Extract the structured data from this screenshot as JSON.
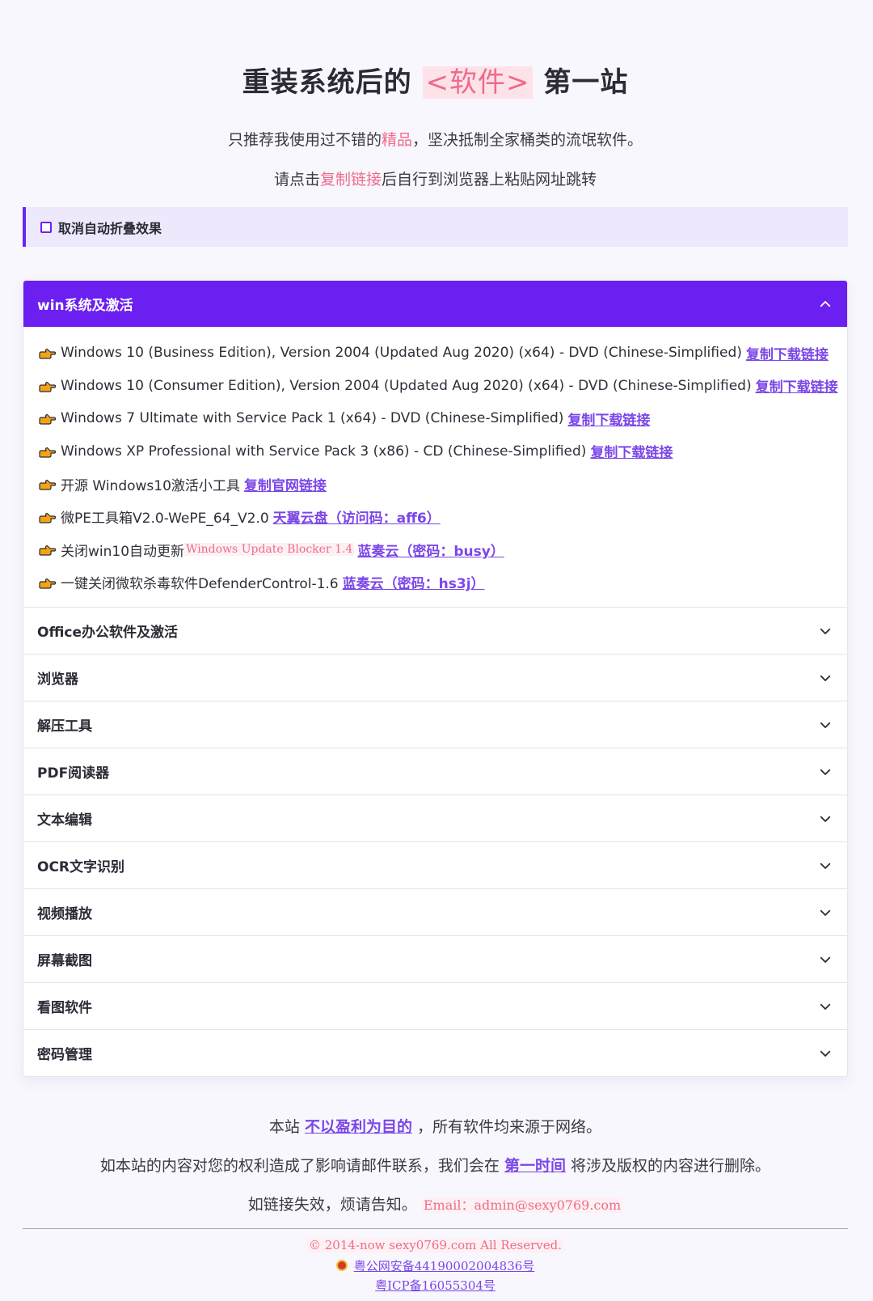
{
  "hero": {
    "title_before": "重装系统后的",
    "title_highlight": "<软件>",
    "title_after": "第一站",
    "line1_before": "只推荐我使用过不错的",
    "line1_highlight": "精品",
    "line1_after": "，坚决抵制全家桶类的流氓软件。",
    "line2_before": "请点击",
    "line2_highlight": "复制链接",
    "line2_after": "后自行到浏览器上粘贴网址跳转"
  },
  "toggle": {
    "label": "取消自动折叠效果"
  },
  "accordion": {
    "open_section": {
      "title": "win系统及激活",
      "items": [
        {
          "text": "Windows 10 (Business Edition), Version 2004 (Updated Aug 2020) (x64) - DVD (Chinese-Simplified)",
          "code": "",
          "link": "复制下载链接"
        },
        {
          "text": "Windows 10 (Consumer Edition), Version 2004 (Updated Aug 2020) (x64) - DVD (Chinese-Simplified)",
          "code": "",
          "link": "复制下载链接"
        },
        {
          "text": "Windows 7 Ultimate with Service Pack 1 (x64) - DVD (Chinese-Simplified)",
          "code": "",
          "link": "复制下载链接"
        },
        {
          "text": "Windows XP Professional with Service Pack 3 (x86) - CD (Chinese-Simplified)",
          "code": "",
          "link": "复制下载链接"
        },
        {
          "text": "开源 Windows10激活小工具",
          "code": "",
          "link": "复制官网链接"
        },
        {
          "text": "微PE工具箱V2.0-WePE_64_V2.0",
          "code": "",
          "link": "天翼云盘（访问码：aff6）"
        },
        {
          "text": "关闭win10自动更新",
          "code": "Windows Update Blocker 1.4",
          "link": "蓝奏云（密码：busy）"
        },
        {
          "text": "一键关闭微软杀毒软件DefenderControl-1.6",
          "code": "",
          "link": "蓝奏云（密码：hs3j）"
        }
      ]
    },
    "sections": [
      "Office办公软件及激活",
      "浏览器",
      "解压工具",
      "PDF阅读器",
      "文本编辑",
      "OCR文字识别",
      "视频播放",
      "屏幕截图",
      "看图软件",
      "密码管理"
    ]
  },
  "footer": {
    "line1_before": "本站",
    "line1_link": "不以盈利为目的",
    "line1_after": "，所有软件均来源于网络。",
    "line2_before": "如本站的内容对您的权利造成了影响请邮件联系，我们会在",
    "line2_link": "第一时间",
    "line2_after": "将涉及版权的内容进行删除。",
    "line3_text": "如链接失效，烦请告知。",
    "line3_email": "Email：admin@sexy0769.com",
    "copyright": "© 2014-now sexy0769.com All Reserved.",
    "police_beian": "粤公网安备44190002004836号",
    "icp": "粤ICP备16055304号"
  },
  "colors": {
    "accent": "#6b1ff0",
    "link": "#7b47e8",
    "highlight": "#ef6b8a",
    "background": "#f8f7fd"
  },
  "icons": {
    "item_icon": "pointing-hand-icon",
    "open_chevron": "chevron-up-icon",
    "closed_chevron": "chevron-down-icon",
    "police_badge": "police-badge-icon"
  }
}
